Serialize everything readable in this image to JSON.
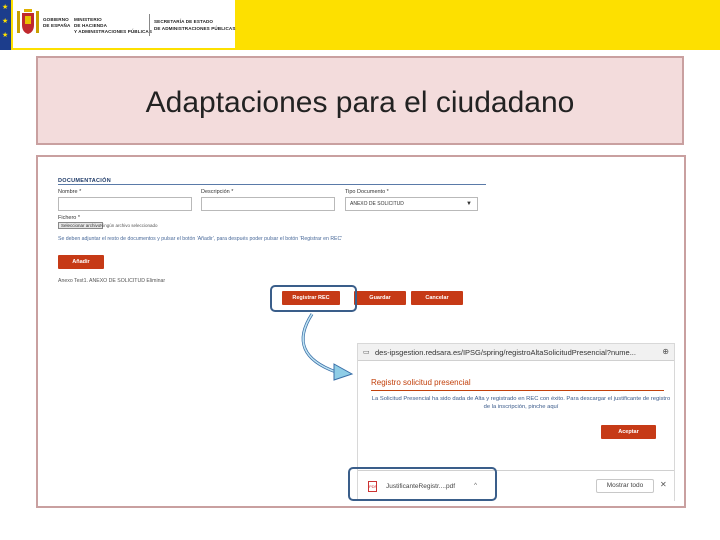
{
  "header": {
    "gov_line1": "GOBIERNO",
    "gov_line2": "DE ESPAÑA",
    "ministry_line1": "MINISTERIO",
    "ministry_line2": "DE HACIENDA",
    "ministry_line3": "Y ADMINISTRACIONES PÚBLICAS",
    "secretariat_line1": "SECRETARÍA DE ESTADO",
    "secretariat_line2": "DE ADMINISTRACIONES PÚBLICAS",
    "colors": {
      "band": "#fde000",
      "eu_blue": "#1c3d8c",
      "title_bg": "#f3dcdc"
    }
  },
  "title": "Adaptaciones para el ciudadano",
  "form": {
    "section_heading": "DOCUMENTACIÓN",
    "name_label": "Nombre *",
    "description_label": "Descripción *",
    "doc_type_label": "Tipo Documento *",
    "doc_type_value": "ANEXO DE SOLICITUD",
    "file_label": "Fichero *",
    "file_button": "Seleccionar archivo",
    "file_status": "Ningún archivo seleccionado",
    "instruction": "Se deben adjuntar el resto de documentos y pulsar el botón 'Añadir', para después poder pulsar el botón 'Registrar en REC'",
    "add_button": "Añadir",
    "attached_doc": "Anexo Test1. ANEXO DE SOLICITUD Eliminar"
  },
  "actions": {
    "register_button": "Registrar REC",
    "save_button": "Guardar",
    "cancel_button": "Cancelar"
  },
  "popup": {
    "url": "des-ipsgestion.redsara.es/IPSG/spring/registroAltaSolicitudPresencial?nume...",
    "heading": "Registro solicitud presencial",
    "message": "La Solicitud Presencial ha sido dada de Alta y registrado en REC con éxito. Para descargar el justificante de registro de la inscripción, pinche aquí",
    "accept_button": "Aceptar",
    "download_file": "JustificanteRegistr....pdf",
    "show_all": "Mostrar todo"
  }
}
